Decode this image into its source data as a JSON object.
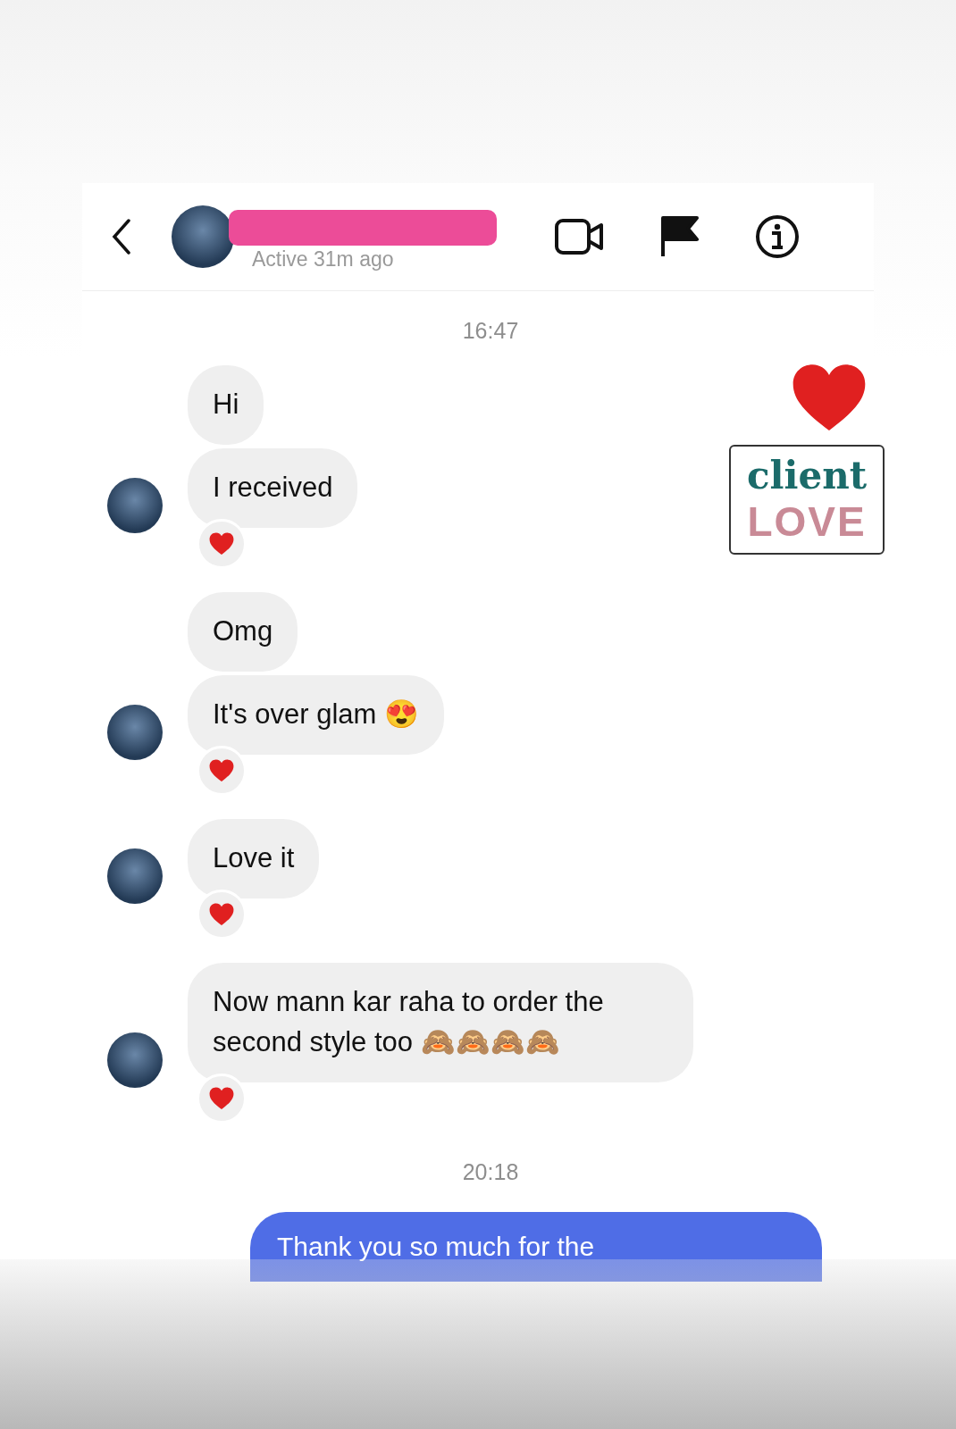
{
  "header": {
    "status": "Active 31m ago"
  },
  "sticker": {
    "line_1": "client",
    "line_2": "LOVE"
  },
  "timestamp_1": "16:47",
  "groups": [
    {
      "messages": [
        "Hi",
        "I received"
      ],
      "reaction": true
    },
    {
      "messages": [
        "Omg",
        "It's over glam 😍"
      ],
      "reaction": true
    },
    {
      "messages": [
        "Love it"
      ],
      "reaction": true
    },
    {
      "messages": [
        "Now mann kar raha to order the second style too 🙈🙈🙈🙈"
      ],
      "reaction": true
    }
  ],
  "timestamp_2": "20:18",
  "outgoing": {
    "text": "Thank you so much for the"
  }
}
